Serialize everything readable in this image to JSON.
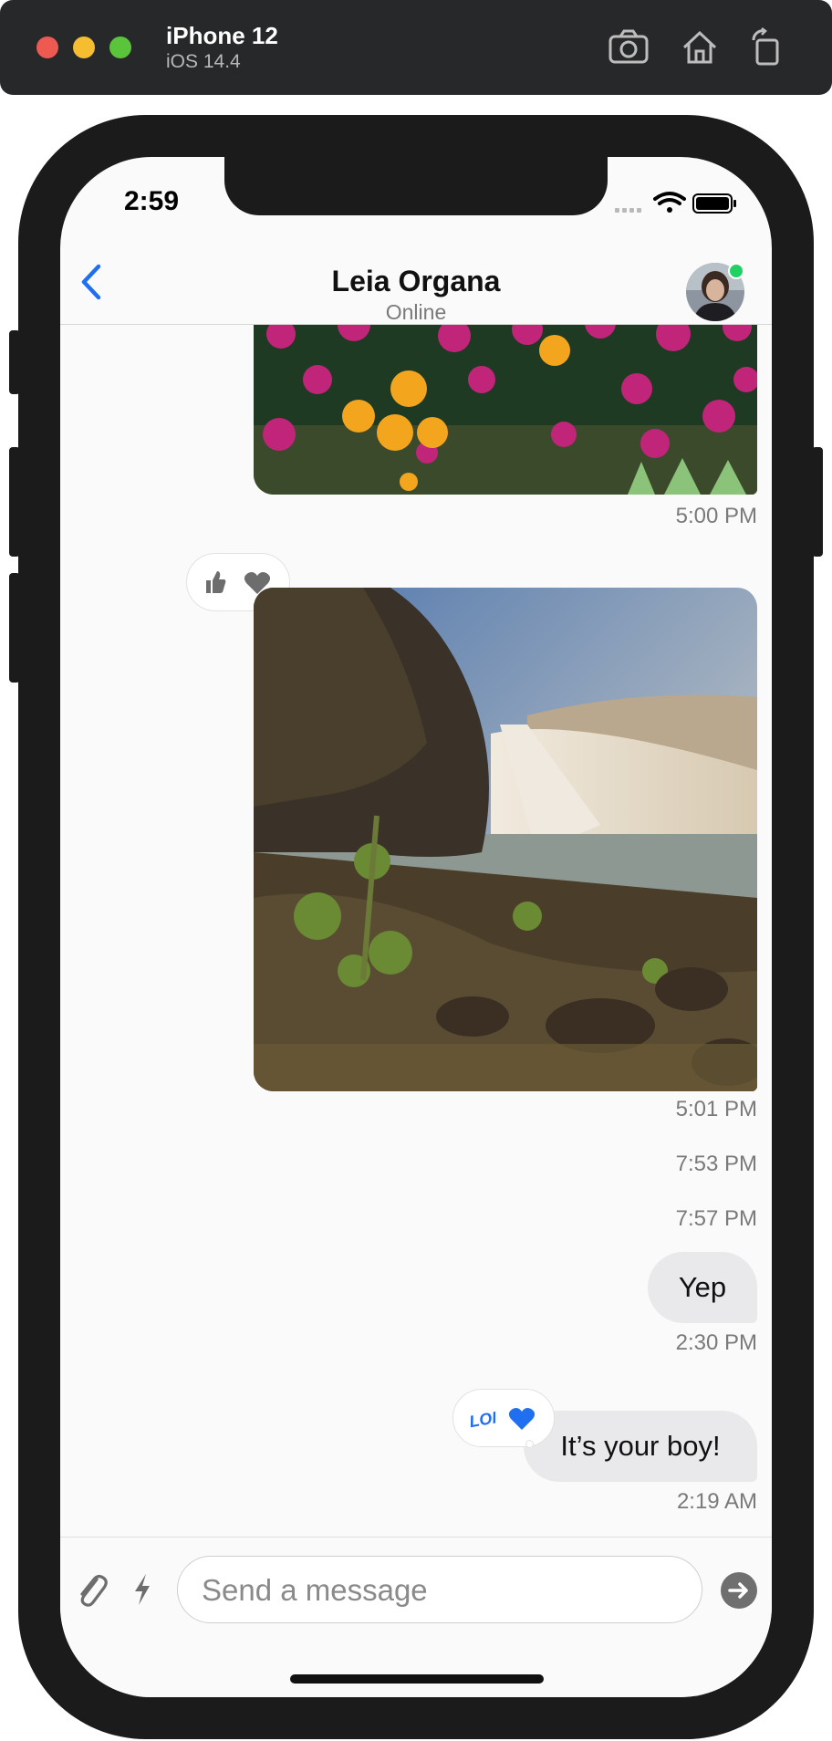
{
  "window": {
    "title": "iPhone 12",
    "subtitle": "iOS 14.4",
    "toolbar_icons": [
      "screenshot-icon",
      "home-icon",
      "rotate-icon"
    ]
  },
  "status_bar": {
    "time": "2:59",
    "icons": [
      "cellular-icon",
      "wifi-icon",
      "battery-icon"
    ]
  },
  "header": {
    "contact_name": "Leia Organa",
    "contact_status": "Online",
    "back_icon": "chevron-left-icon",
    "presence": "online"
  },
  "messages": [
    {
      "type": "image",
      "subject": "flowers",
      "timestamp": "5:00 PM"
    },
    {
      "type": "image",
      "subject": "waterfall",
      "timestamp": "5:01 PM",
      "reactions": [
        "thumbs-up-icon",
        "heart-icon"
      ]
    },
    {
      "type": "timestamp",
      "timestamp": "7:53 PM"
    },
    {
      "type": "timestamp",
      "timestamp": "7:57 PM"
    },
    {
      "type": "text",
      "text": "Yep",
      "timestamp": "2:30 PM"
    },
    {
      "type": "text",
      "text": "It’s your boy!",
      "timestamp": "2:19 AM",
      "reactions": [
        "lol-icon",
        "heart-icon"
      ]
    }
  ],
  "composer": {
    "placeholder": "Send a message",
    "value": "",
    "icons": [
      "paperclip-icon",
      "lightning-icon",
      "send-icon"
    ]
  },
  "colors": {
    "accent": "#1f6ff0",
    "online": "#20d264",
    "bubble": "#e9e9eb",
    "device": "#1b1b1b"
  }
}
